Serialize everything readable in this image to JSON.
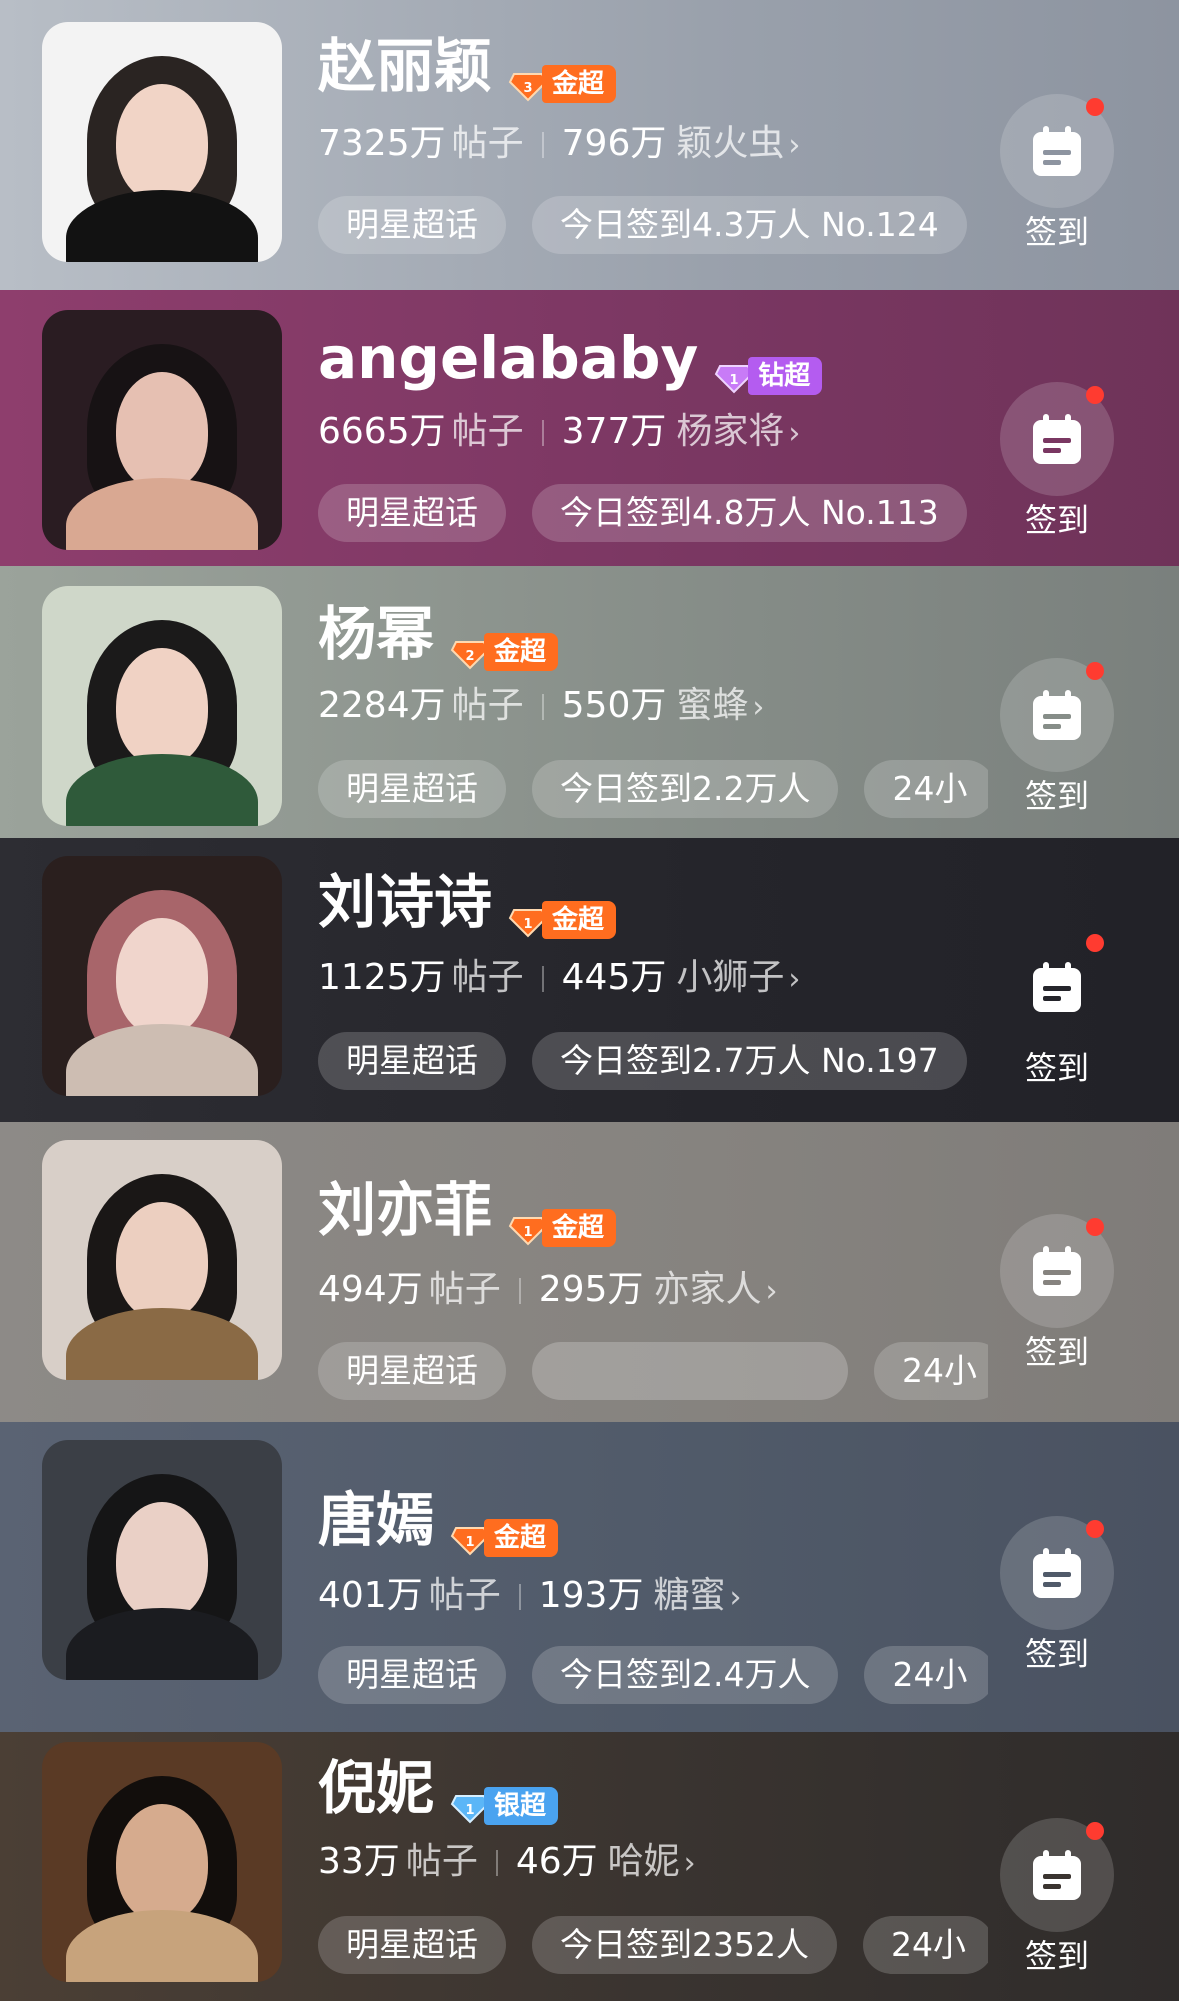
{
  "rows": [
    {
      "name": "赵丽颖",
      "badge": {
        "label": "金超",
        "level": "3",
        "tier": "gold"
      },
      "posts": "7325万",
      "posts_unit": "帖子",
      "fans": "796万",
      "fan_name": "颖火虫",
      "tag": "明星超话",
      "checkin": "今日签到4.3万人 No.124",
      "extra": "",
      "sign_label": "签到",
      "bg": "#8f98a6"
    },
    {
      "name": "angelababy",
      "badge": {
        "label": "钻超",
        "level": "1",
        "tier": "diamond"
      },
      "posts": "6665万",
      "posts_unit": "帖子",
      "fans": "377万",
      "fan_name": "杨家将",
      "tag": "明星超话",
      "checkin": "今日签到4.8万人 No.113",
      "extra": "",
      "sign_label": "签到",
      "bg": "#7e3a6a"
    },
    {
      "name": "杨幂",
      "badge": {
        "label": "金超",
        "level": "2",
        "tier": "gold"
      },
      "posts": "2284万",
      "posts_unit": "帖子",
      "fans": "550万",
      "fan_name": "蜜蜂",
      "tag": "明星超话",
      "checkin": "今日签到2.2万人",
      "extra": "24小",
      "sign_label": "签到",
      "bg": "#7f8780"
    },
    {
      "name": "刘诗诗",
      "badge": {
        "label": "金超",
        "level": "1",
        "tier": "gold"
      },
      "posts": "1125万",
      "posts_unit": "帖子",
      "fans": "445万",
      "fan_name": "小狮子",
      "tag": "明星超话",
      "checkin": "今日签到2.7万人 No.197",
      "extra": "",
      "sign_label": "签到",
      "bg": "#2a2a30"
    },
    {
      "name": "刘亦菲",
      "badge": {
        "label": "金超",
        "level": "1",
        "tier": "gold"
      },
      "posts": "494万",
      "posts_unit": "帖子",
      "fans": "295万",
      "fan_name": "亦家人",
      "tag": "明星超话",
      "checkin": "",
      "extra": "24小",
      "sign_label": "签到",
      "bg": "#8a8683"
    },
    {
      "name": "唐嫣",
      "badge": {
        "label": "金超",
        "level": "1",
        "tier": "gold"
      },
      "posts": "401万",
      "posts_unit": "帖子",
      "fans": "193万",
      "fan_name": "糖蜜",
      "tag": "明星超话",
      "checkin": "今日签到2.4万人",
      "extra": "24小",
      "sign_label": "签到",
      "bg": "#4f5868"
    },
    {
      "name": "倪妮",
      "badge": {
        "label": "银超",
        "level": "1",
        "tier": "silver"
      },
      "posts": "33万",
      "posts_unit": "帖子",
      "fans": "46万",
      "fan_name": "哈妮",
      "tag": "明星超话",
      "checkin": "今日签到2352人",
      "extra": "24小",
      "sign_label": "签到",
      "bg": "#3a3430"
    }
  ],
  "colors": {
    "gold_badge": "#ff6d1f",
    "diamond_badge": "#b45cf0",
    "silver_badge": "#4aa3f0",
    "red_dot": "#ff3b30"
  },
  "icons": {
    "sign": "calendar-icon",
    "chevron": "chevron-right-icon",
    "badge": "diamond-icon"
  }
}
